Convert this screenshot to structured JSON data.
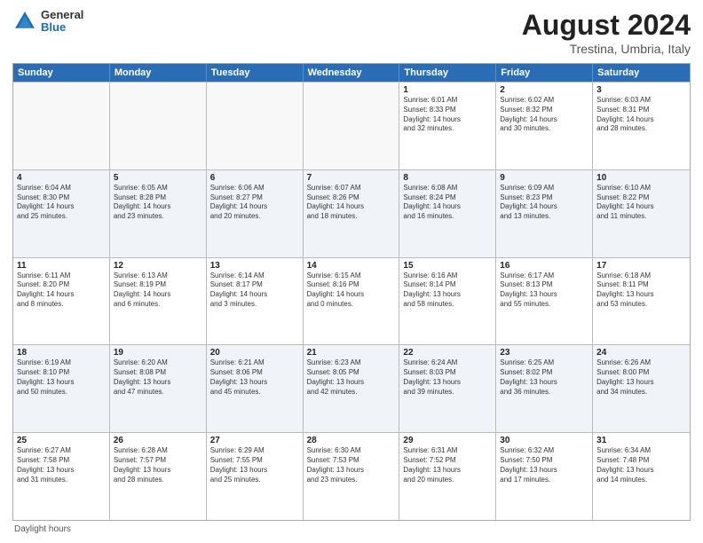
{
  "header": {
    "logo_general": "General",
    "logo_blue": "Blue",
    "month_year": "August 2024",
    "location": "Trestina, Umbria, Italy"
  },
  "days_of_week": [
    "Sunday",
    "Monday",
    "Tuesday",
    "Wednesday",
    "Thursday",
    "Friday",
    "Saturday"
  ],
  "rows": [
    [
      {
        "day": "",
        "lines": [],
        "empty": true
      },
      {
        "day": "",
        "lines": [],
        "empty": true
      },
      {
        "day": "",
        "lines": [],
        "empty": true
      },
      {
        "day": "",
        "lines": [],
        "empty": true
      },
      {
        "day": "1",
        "lines": [
          "Sunrise: 6:01 AM",
          "Sunset: 8:33 PM",
          "Daylight: 14 hours",
          "and 32 minutes."
        ],
        "empty": false
      },
      {
        "day": "2",
        "lines": [
          "Sunrise: 6:02 AM",
          "Sunset: 8:32 PM",
          "Daylight: 14 hours",
          "and 30 minutes."
        ],
        "empty": false
      },
      {
        "day": "3",
        "lines": [
          "Sunrise: 6:03 AM",
          "Sunset: 8:31 PM",
          "Daylight: 14 hours",
          "and 28 minutes."
        ],
        "empty": false
      }
    ],
    [
      {
        "day": "4",
        "lines": [
          "Sunrise: 6:04 AM",
          "Sunset: 8:30 PM",
          "Daylight: 14 hours",
          "and 25 minutes."
        ],
        "empty": false
      },
      {
        "day": "5",
        "lines": [
          "Sunrise: 6:05 AM",
          "Sunset: 8:28 PM",
          "Daylight: 14 hours",
          "and 23 minutes."
        ],
        "empty": false
      },
      {
        "day": "6",
        "lines": [
          "Sunrise: 6:06 AM",
          "Sunset: 8:27 PM",
          "Daylight: 14 hours",
          "and 20 minutes."
        ],
        "empty": false
      },
      {
        "day": "7",
        "lines": [
          "Sunrise: 6:07 AM",
          "Sunset: 8:26 PM",
          "Daylight: 14 hours",
          "and 18 minutes."
        ],
        "empty": false
      },
      {
        "day": "8",
        "lines": [
          "Sunrise: 6:08 AM",
          "Sunset: 8:24 PM",
          "Daylight: 14 hours",
          "and 16 minutes."
        ],
        "empty": false
      },
      {
        "day": "9",
        "lines": [
          "Sunrise: 6:09 AM",
          "Sunset: 8:23 PM",
          "Daylight: 14 hours",
          "and 13 minutes."
        ],
        "empty": false
      },
      {
        "day": "10",
        "lines": [
          "Sunrise: 6:10 AM",
          "Sunset: 8:22 PM",
          "Daylight: 14 hours",
          "and 11 minutes."
        ],
        "empty": false
      }
    ],
    [
      {
        "day": "11",
        "lines": [
          "Sunrise: 6:11 AM",
          "Sunset: 8:20 PM",
          "Daylight: 14 hours",
          "and 8 minutes."
        ],
        "empty": false
      },
      {
        "day": "12",
        "lines": [
          "Sunrise: 6:13 AM",
          "Sunset: 8:19 PM",
          "Daylight: 14 hours",
          "and 6 minutes."
        ],
        "empty": false
      },
      {
        "day": "13",
        "lines": [
          "Sunrise: 6:14 AM",
          "Sunset: 8:17 PM",
          "Daylight: 14 hours",
          "and 3 minutes."
        ],
        "empty": false
      },
      {
        "day": "14",
        "lines": [
          "Sunrise: 6:15 AM",
          "Sunset: 8:16 PM",
          "Daylight: 14 hours",
          "and 0 minutes."
        ],
        "empty": false
      },
      {
        "day": "15",
        "lines": [
          "Sunrise: 6:16 AM",
          "Sunset: 8:14 PM",
          "Daylight: 13 hours",
          "and 58 minutes."
        ],
        "empty": false
      },
      {
        "day": "16",
        "lines": [
          "Sunrise: 6:17 AM",
          "Sunset: 8:13 PM",
          "Daylight: 13 hours",
          "and 55 minutes."
        ],
        "empty": false
      },
      {
        "day": "17",
        "lines": [
          "Sunrise: 6:18 AM",
          "Sunset: 8:11 PM",
          "Daylight: 13 hours",
          "and 53 minutes."
        ],
        "empty": false
      }
    ],
    [
      {
        "day": "18",
        "lines": [
          "Sunrise: 6:19 AM",
          "Sunset: 8:10 PM",
          "Daylight: 13 hours",
          "and 50 minutes."
        ],
        "empty": false
      },
      {
        "day": "19",
        "lines": [
          "Sunrise: 6:20 AM",
          "Sunset: 8:08 PM",
          "Daylight: 13 hours",
          "and 47 minutes."
        ],
        "empty": false
      },
      {
        "day": "20",
        "lines": [
          "Sunrise: 6:21 AM",
          "Sunset: 8:06 PM",
          "Daylight: 13 hours",
          "and 45 minutes."
        ],
        "empty": false
      },
      {
        "day": "21",
        "lines": [
          "Sunrise: 6:23 AM",
          "Sunset: 8:05 PM",
          "Daylight: 13 hours",
          "and 42 minutes."
        ],
        "empty": false
      },
      {
        "day": "22",
        "lines": [
          "Sunrise: 6:24 AM",
          "Sunset: 8:03 PM",
          "Daylight: 13 hours",
          "and 39 minutes."
        ],
        "empty": false
      },
      {
        "day": "23",
        "lines": [
          "Sunrise: 6:25 AM",
          "Sunset: 8:02 PM",
          "Daylight: 13 hours",
          "and 36 minutes."
        ],
        "empty": false
      },
      {
        "day": "24",
        "lines": [
          "Sunrise: 6:26 AM",
          "Sunset: 8:00 PM",
          "Daylight: 13 hours",
          "and 34 minutes."
        ],
        "empty": false
      }
    ],
    [
      {
        "day": "25",
        "lines": [
          "Sunrise: 6:27 AM",
          "Sunset: 7:58 PM",
          "Daylight: 13 hours",
          "and 31 minutes."
        ],
        "empty": false
      },
      {
        "day": "26",
        "lines": [
          "Sunrise: 6:28 AM",
          "Sunset: 7:57 PM",
          "Daylight: 13 hours",
          "and 28 minutes."
        ],
        "empty": false
      },
      {
        "day": "27",
        "lines": [
          "Sunrise: 6:29 AM",
          "Sunset: 7:55 PM",
          "Daylight: 13 hours",
          "and 25 minutes."
        ],
        "empty": false
      },
      {
        "day": "28",
        "lines": [
          "Sunrise: 6:30 AM",
          "Sunset: 7:53 PM",
          "Daylight: 13 hours",
          "and 23 minutes."
        ],
        "empty": false
      },
      {
        "day": "29",
        "lines": [
          "Sunrise: 6:31 AM",
          "Sunset: 7:52 PM",
          "Daylight: 13 hours",
          "and 20 minutes."
        ],
        "empty": false
      },
      {
        "day": "30",
        "lines": [
          "Sunrise: 6:32 AM",
          "Sunset: 7:50 PM",
          "Daylight: 13 hours",
          "and 17 minutes."
        ],
        "empty": false
      },
      {
        "day": "31",
        "lines": [
          "Sunrise: 6:34 AM",
          "Sunset: 7:48 PM",
          "Daylight: 13 hours",
          "and 14 minutes."
        ],
        "empty": false
      }
    ]
  ],
  "footer": "Daylight hours"
}
